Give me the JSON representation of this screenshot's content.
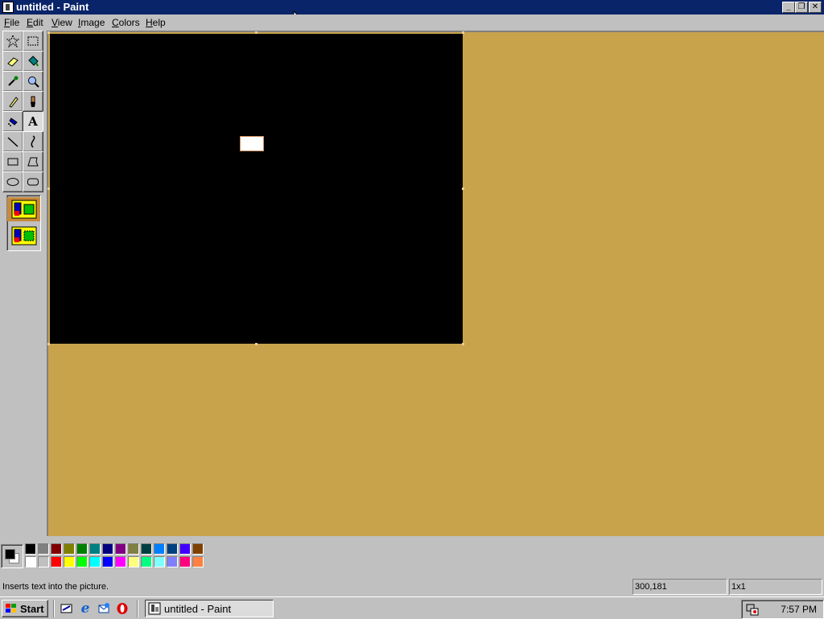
{
  "window": {
    "title": "untitled - Paint",
    "buttons": [
      "minimize",
      "restore",
      "close"
    ]
  },
  "menubar": {
    "items": [
      {
        "label": "File",
        "accel": "F",
        "rest": "ile"
      },
      {
        "label": "Edit",
        "accel": "E",
        "rest": "dit"
      },
      {
        "label": "View",
        "accel": "V",
        "rest": "iew"
      },
      {
        "label": "Image",
        "accel": "I",
        "rest": "mage"
      },
      {
        "label": "Colors",
        "accel": "C",
        "rest": "olors"
      },
      {
        "label": "Help",
        "accel": "H",
        "rest": "elp"
      }
    ]
  },
  "toolbox": {
    "tools": [
      {
        "name": "free-form-select",
        "icon": "star-select-icon"
      },
      {
        "name": "select",
        "icon": "rect-select-icon"
      },
      {
        "name": "eraser",
        "icon": "eraser-icon"
      },
      {
        "name": "fill",
        "icon": "fill-bucket-icon"
      },
      {
        "name": "pick-color",
        "icon": "eyedropper-icon"
      },
      {
        "name": "magnifier",
        "icon": "magnifier-icon"
      },
      {
        "name": "pencil",
        "icon": "pencil-icon"
      },
      {
        "name": "brush",
        "icon": "brush-icon"
      },
      {
        "name": "airbrush",
        "icon": "airbrush-icon"
      },
      {
        "name": "text",
        "icon": "text-icon",
        "glyph": "A",
        "selected": true
      },
      {
        "name": "line",
        "icon": "line-icon"
      },
      {
        "name": "curve",
        "icon": "curve-icon"
      },
      {
        "name": "rectangle",
        "icon": "rectangle-icon"
      },
      {
        "name": "polygon",
        "icon": "polygon-icon"
      },
      {
        "name": "ellipse",
        "icon": "ellipse-icon"
      },
      {
        "name": "rounded-rectangle",
        "icon": "rounded-rect-icon"
      }
    ],
    "options": [
      {
        "name": "opaque-background",
        "selected": true
      },
      {
        "name": "transparent-background",
        "selected": false
      }
    ]
  },
  "canvas": {
    "background": "#000000",
    "workspace_color": "#c9a24c"
  },
  "palette": {
    "foreground": "#000000",
    "background": "#ffffff",
    "top_row": [
      "#000000",
      "#808080",
      "#800000",
      "#808000",
      "#008000",
      "#008080",
      "#000080",
      "#800080",
      "#808040",
      "#004040",
      "#0080ff",
      "#004080",
      "#4000ff",
      "#804000"
    ],
    "bottom_row": [
      "#ffffff",
      "#c0c0c0",
      "#ff0000",
      "#ffff00",
      "#00ff00",
      "#00ffff",
      "#0000ff",
      "#ff00ff",
      "#ffff80",
      "#00ff80",
      "#80ffff",
      "#8080ff",
      "#ff0080",
      "#ff8040"
    ]
  },
  "statusbar": {
    "message": "Inserts text into the picture.",
    "coords": "300,181",
    "size": "1x1"
  },
  "taskbar": {
    "start_label": "Start",
    "quicklaunch": [
      "show-desktop-icon",
      "internet-explorer-icon",
      "outlook-express-icon",
      "opera-icon"
    ],
    "tasks": [
      {
        "label": "untitled - Paint",
        "active": true
      }
    ],
    "clock": "7:57 PM"
  }
}
